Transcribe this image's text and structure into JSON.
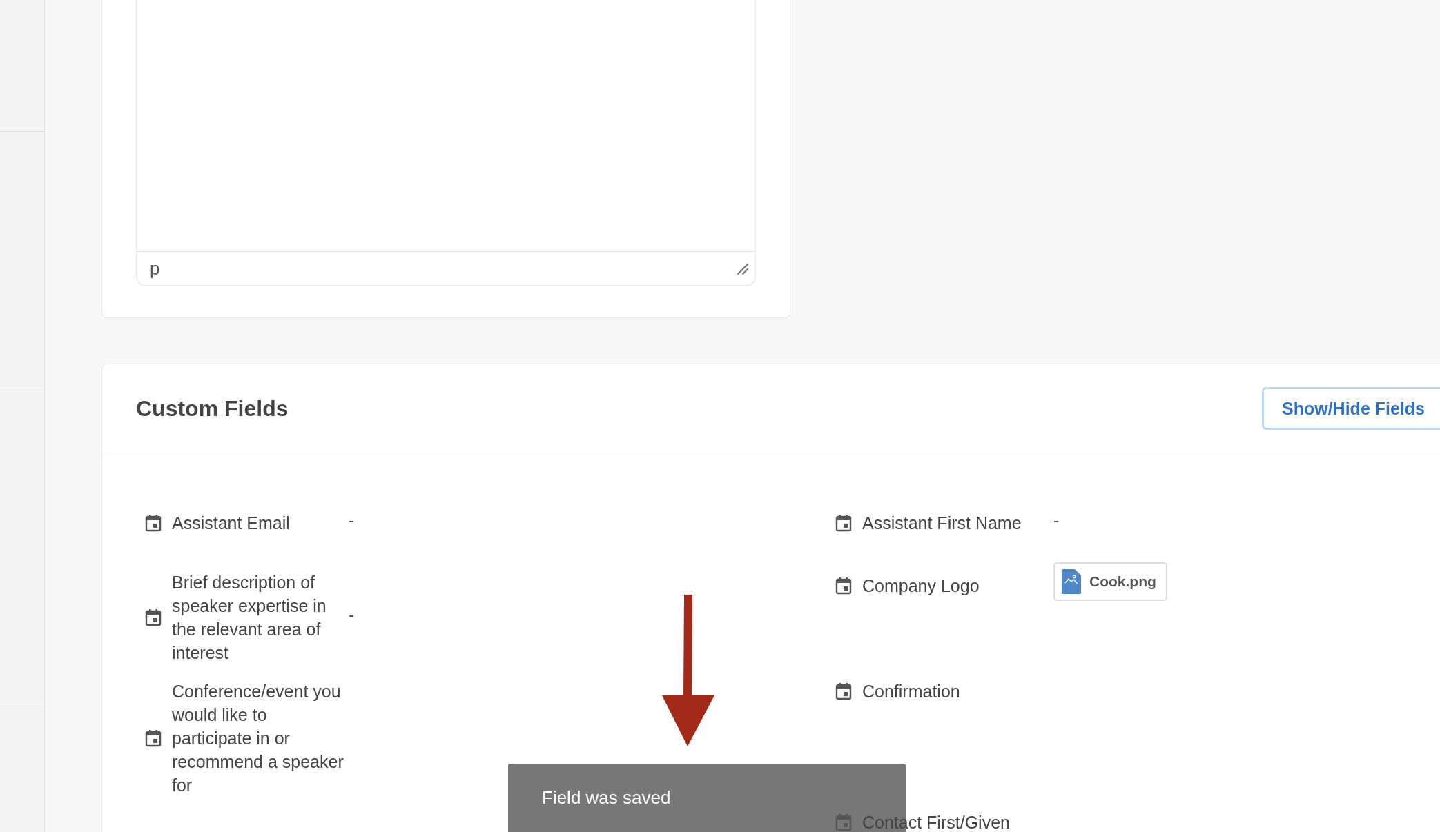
{
  "editor": {
    "status_path": "p"
  },
  "custom_fields": {
    "title": "Custom Fields",
    "show_hide_button": "Show/Hide Fields",
    "rows": [
      {
        "left": {
          "label": "Assistant Email",
          "kind": "text",
          "value": "-"
        },
        "right": {
          "label": "Assistant First Name",
          "kind": "text",
          "value": "-"
        }
      },
      {
        "left": {
          "label": "Brief description of speaker expertise in the relevant area of interest",
          "kind": "text",
          "value": "-"
        },
        "right": {
          "label": "Company Logo",
          "kind": "file",
          "value": "Cook.png"
        }
      },
      {
        "left": {
          "label": "Conference/event you would like to participate in or recommend a speaker for",
          "kind": "empty"
        },
        "right": {
          "label": "Confirmation",
          "kind": "empty"
        }
      },
      {
        "right": {
          "label": "Contact First/Given",
          "kind": "empty"
        }
      }
    ]
  },
  "toast": {
    "message": "Field was saved"
  }
}
